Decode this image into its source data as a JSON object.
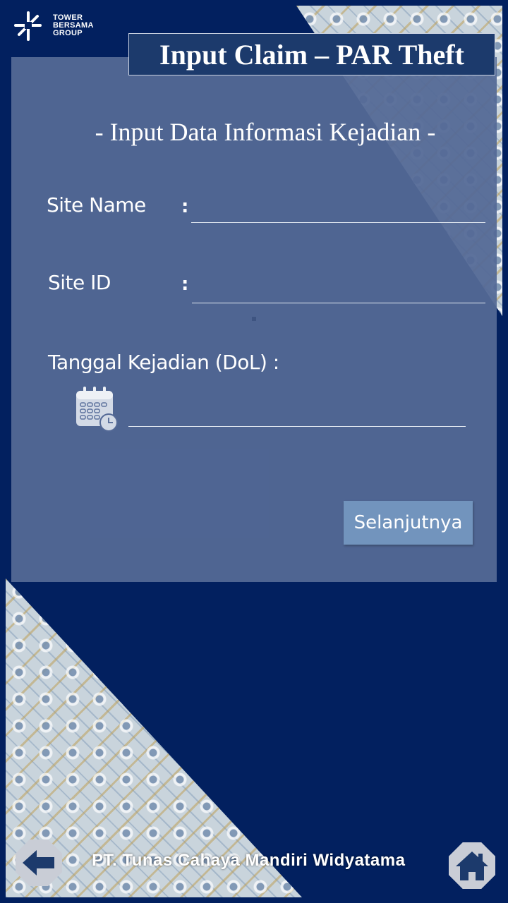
{
  "logo": {
    "line1": "TOWER",
    "line2": "BERSAMA",
    "line3": "GROUP"
  },
  "header": {
    "title": "Input Claim – PAR Theft"
  },
  "form": {
    "subtitle": "- Input Data Informasi Kejadian -",
    "site_name_label": "Site Name",
    "site_id_label": "Site ID",
    "colon": ":",
    "dol_label": "Tanggal Kejadian (DoL) :",
    "site_name_value": "",
    "site_id_value": "",
    "dol_value": "",
    "next_label": "Selanjutnya"
  },
  "footer": {
    "company": "PT. Tunas Cahaya Mandiri Widyatama"
  },
  "colors": {
    "background": "#02205f",
    "panel": "#546996",
    "title_box": "#1c3a6c",
    "button": "#7294bd"
  },
  "icons": [
    "calendar-clock-icon",
    "back-arrow-icon",
    "home-icon"
  ]
}
